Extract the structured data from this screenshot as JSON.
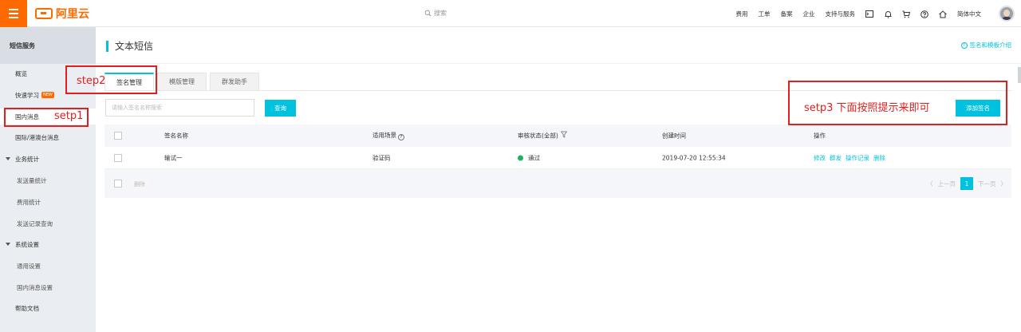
{
  "topbar": {
    "logo_text": "阿里云",
    "search_placeholder": "搜索",
    "nav": [
      "费用",
      "工单",
      "备案",
      "企业",
      "支持与服务"
    ],
    "language": "简体中文"
  },
  "sidebar": {
    "title": "短信服务",
    "items": [
      {
        "label": "概览"
      },
      {
        "label": "快速学习",
        "badge": "NEW"
      },
      {
        "label": "国内消息"
      },
      {
        "label": "国际/港澳台消息"
      },
      {
        "label": "业务统计"
      },
      {
        "label": "发送量统计"
      },
      {
        "label": "费用统计"
      },
      {
        "label": "发送记录查询"
      },
      {
        "label": "系统设置"
      },
      {
        "label": "通用设置"
      },
      {
        "label": "国内消息设置"
      },
      {
        "label": "帮助文档"
      }
    ]
  },
  "page": {
    "title": "文本短信",
    "help_link": "签名和模板介绍",
    "tabs": [
      "签名管理",
      "模版管理",
      "群发助手"
    ],
    "search_placeholder": "请输入签名名称搜索",
    "query_label": "查询",
    "add_label": "添加签名"
  },
  "table": {
    "headers": {
      "name": "签名名称",
      "scene": "适用场景",
      "status": "审核状态(全部)",
      "created": "创建时间",
      "ops": "操作"
    },
    "rows": [
      {
        "name": "输试一",
        "scene": "验证码",
        "status": "通过",
        "created": "2019-07-20 12:55:34",
        "ops": [
          "修改",
          "群发",
          "操作记录",
          "删除"
        ]
      }
    ],
    "delete_label": "删除",
    "pager": {
      "prev": "上一页",
      "current": "1",
      "next": "下一页"
    }
  },
  "annotations": {
    "step1": "setp1",
    "step2": "step2",
    "step3": "setp3  下面按照提示来即可"
  },
  "colors": {
    "accent": "#00c1de",
    "brand": "#ff6a00",
    "annotation": "#e02020",
    "success": "#1eb25c"
  }
}
